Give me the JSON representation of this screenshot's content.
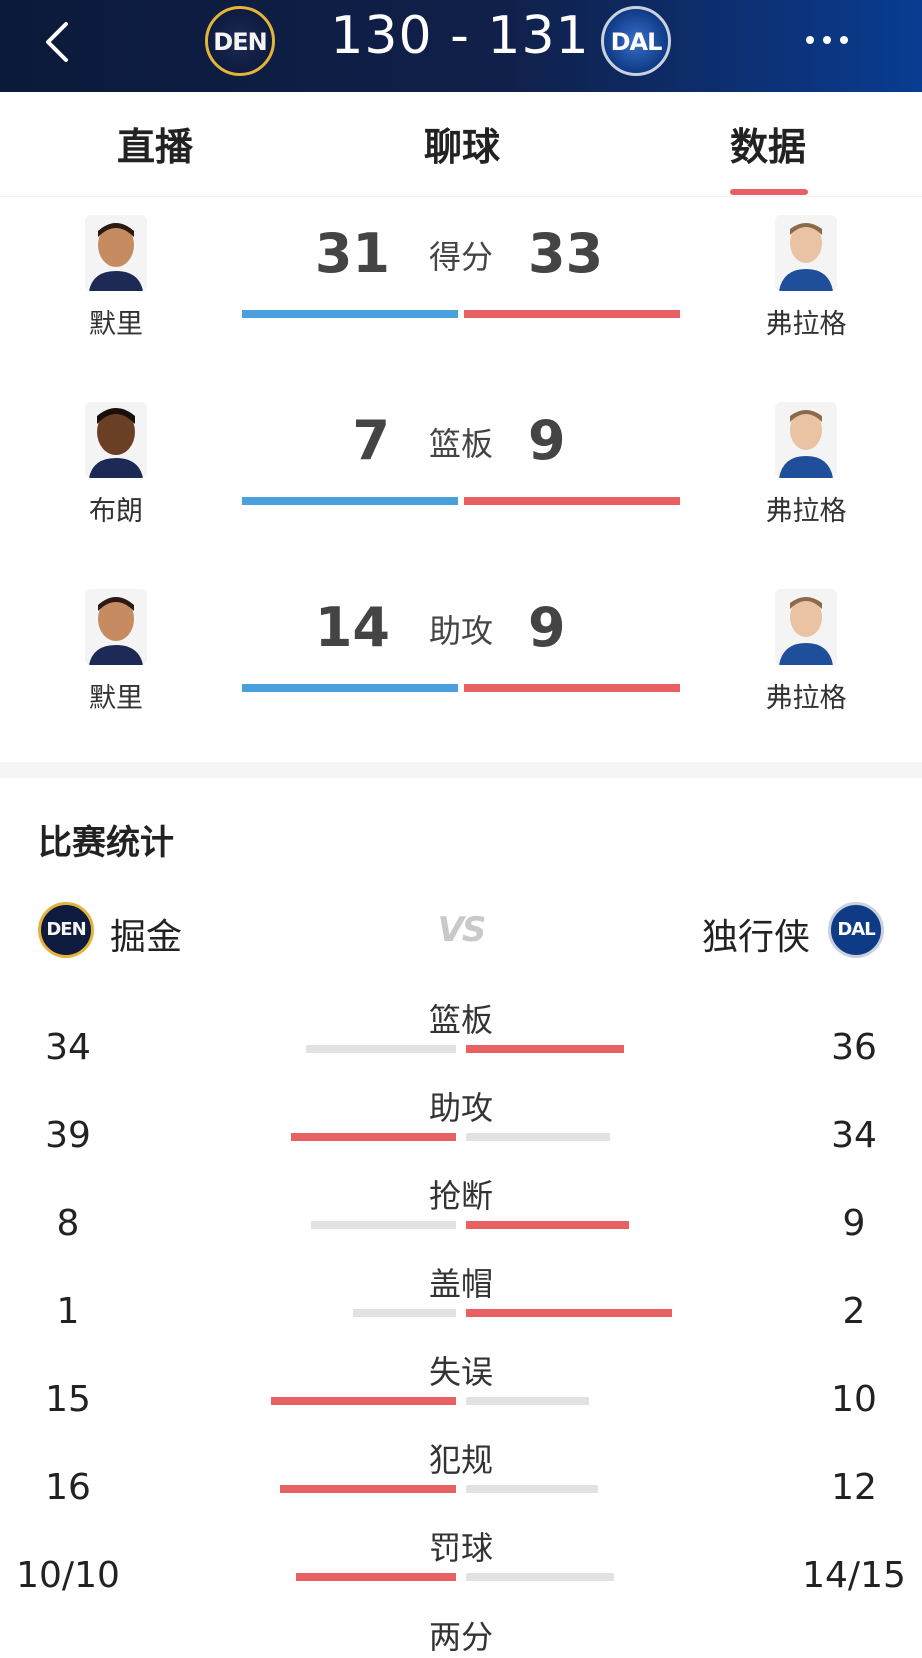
{
  "header": {
    "home_abbr": "DEN",
    "away_abbr": "DAL",
    "score": "130 - 131"
  },
  "tabs": [
    {
      "label": "直播",
      "active": false
    },
    {
      "label": "聊球",
      "active": false
    },
    {
      "label": "数据",
      "active": true
    }
  ],
  "leaders": [
    {
      "category": "得分",
      "home_player": "默里",
      "home_value": "31",
      "away_player": "弗拉格",
      "away_value": "33"
    },
    {
      "category": "篮板",
      "home_player": "布朗",
      "home_value": "7",
      "away_player": "弗拉格",
      "away_value": "9"
    },
    {
      "category": "助攻",
      "home_player": "默里",
      "home_value": "14",
      "away_player": "弗拉格",
      "away_value": "9"
    }
  ],
  "game_stats": {
    "title": "比赛统计",
    "home_team": "掘金",
    "away_team": "独行侠",
    "vs_label": "VS",
    "rows": [
      {
        "label": "篮板",
        "home": "34",
        "away": "36",
        "leader": "away"
      },
      {
        "label": "助攻",
        "home": "39",
        "away": "34",
        "leader": "home"
      },
      {
        "label": "抢断",
        "home": "8",
        "away": "9",
        "leader": "away"
      },
      {
        "label": "盖帽",
        "home": "1",
        "away": "2",
        "leader": "away"
      },
      {
        "label": "失误",
        "home": "15",
        "away": "10",
        "leader": "home"
      },
      {
        "label": "犯规",
        "home": "16",
        "away": "12",
        "leader": "home"
      },
      {
        "label": "罚球",
        "home": "10/10",
        "away": "14/15",
        "leader": "home"
      },
      {
        "label": "两分",
        "home": "",
        "away": "",
        "leader": ""
      }
    ]
  },
  "colors": {
    "header_bg": "#0b1a3a",
    "home_bar": "#4aa0dc",
    "away_bar": "#e86062",
    "stat_highlight": "#e86062",
    "stat_muted": "#e2e2e2",
    "tab_underline": "#e86062"
  },
  "icons": {
    "back": "chevron-left-icon",
    "more": "more-horizontal-icon"
  }
}
